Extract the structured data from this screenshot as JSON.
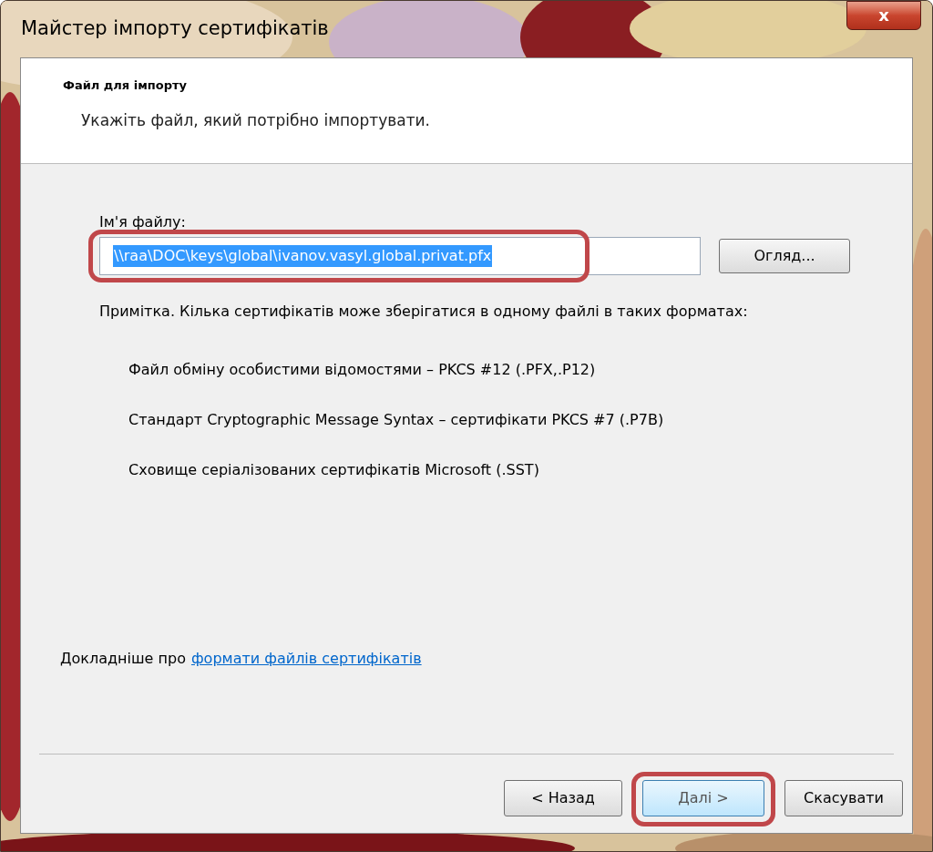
{
  "window": {
    "title": "Майстер імпорту сертифікатів",
    "close_label": "x"
  },
  "header": {
    "title": "Файл для імпорту",
    "subtitle": "Укажіть файл, який потрібно імпортувати."
  },
  "file_field": {
    "label": "Ім'я файлу:",
    "value": "\\\\raa\\DOC\\keys\\global\\ivanov.vasyl.global.privat.pfx",
    "text_selected": true,
    "highlighted": true
  },
  "browse_button": {
    "label": "Огляд..."
  },
  "note": "Примітка. Кілька сертифікатів може зберігатися в одному файлі в таких форматах:",
  "formats": [
    "Файл обміну особистими відомостями – PKCS #12 (.PFX,.P12)",
    "Стандарт Cryptographic Message Syntax – сертифікати PKCS #7 (.P7B)",
    "Сховище серіалізованих сертифікатів Microsoft (.SST)"
  ],
  "more_info": {
    "text": "Докладніше про",
    "link": "формати файлів сертифікатів"
  },
  "buttons": [
    {
      "label": "< Назад",
      "highlighted": false
    },
    {
      "label": "Далі >",
      "highlighted": true
    },
    {
      "label": "Скасувати",
      "highlighted": false
    }
  ]
}
